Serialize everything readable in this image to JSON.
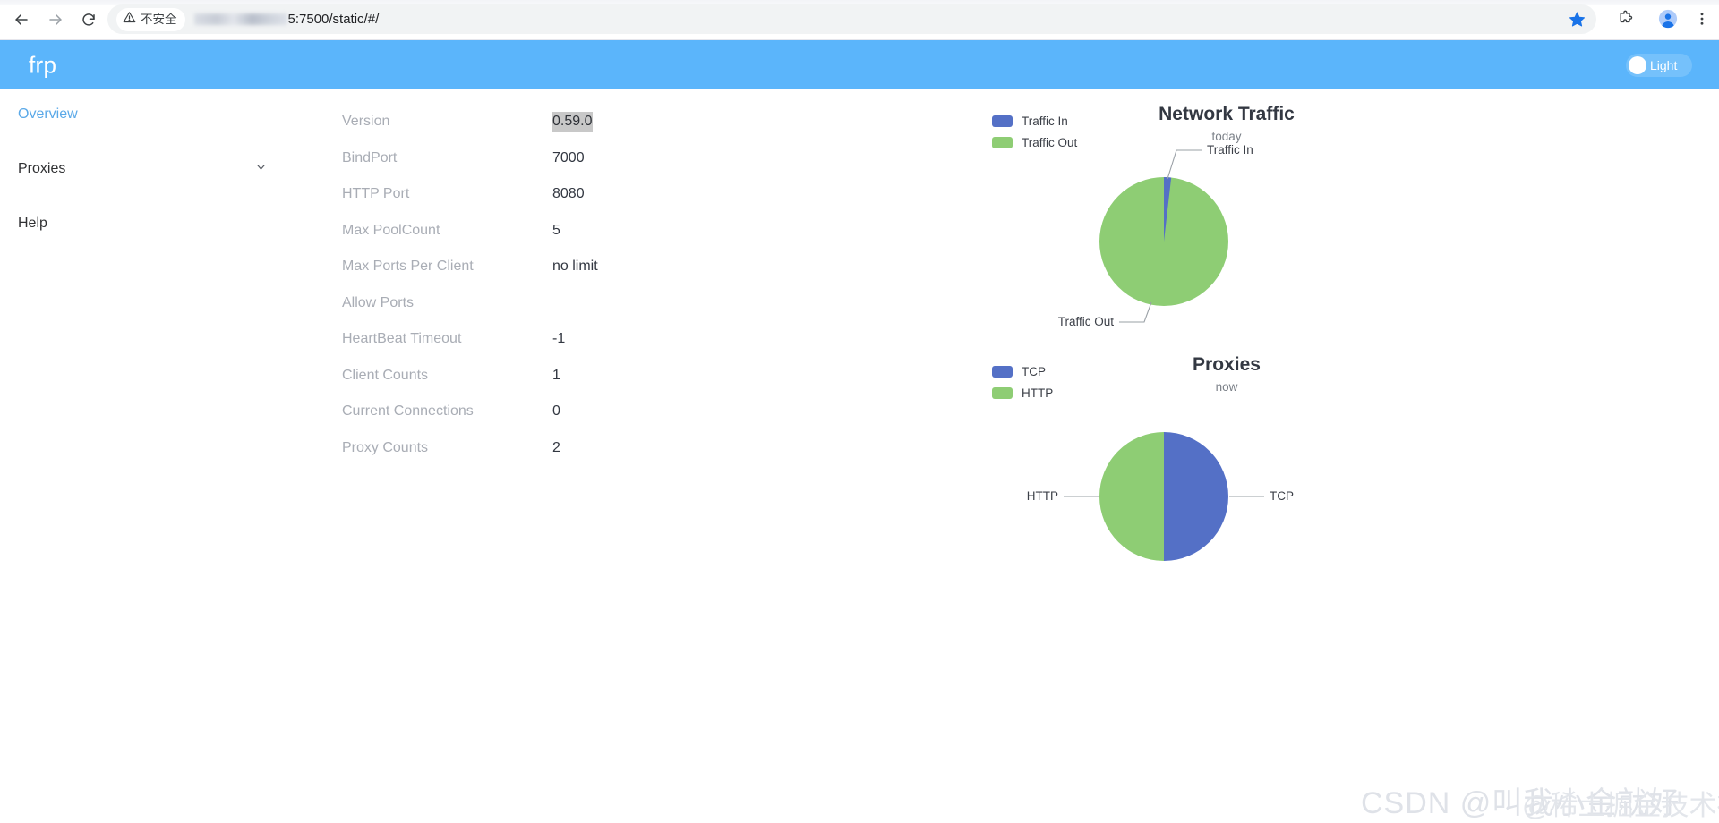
{
  "browser": {
    "back_icon": "arrow-left-icon",
    "forward_icon": "arrow-right-icon",
    "reload_icon": "reload-icon",
    "security_label": "不安全",
    "security_icon": "warning-triangle-icon",
    "url_visible": "5:7500/static/#/",
    "url_redacted": true,
    "bookmark_icon": "star-filled-icon",
    "extensions_icon": "puzzle-piece-icon",
    "profile_icon": "avatar-icon",
    "menu_icon": "three-dot-menu-icon"
  },
  "header": {
    "logo": "frp",
    "theme_toggle_label": "Light",
    "background_color": "#5bb5fb"
  },
  "sidebar": {
    "items": [
      {
        "label": "Overview",
        "active": true
      },
      {
        "label": "Proxies",
        "active": false,
        "expand_icon": "chevron-down-icon"
      },
      {
        "label": "Help",
        "active": false
      }
    ]
  },
  "info": {
    "rows": [
      {
        "key": "Version",
        "value": "0.59.0",
        "selected": true
      },
      {
        "key": "BindPort",
        "value": "7000",
        "selected": false
      },
      {
        "key": "HTTP Port",
        "value": "8080",
        "selected": false
      },
      {
        "key": "Max PoolCount",
        "value": "5",
        "selected": false
      },
      {
        "key": "Max Ports Per Client",
        "value": "no limit",
        "selected": false
      },
      {
        "key": "Allow Ports",
        "value": "",
        "selected": false
      },
      {
        "key": "HeartBeat Timeout",
        "value": "-1",
        "selected": false
      },
      {
        "key": "Client Counts",
        "value": "1",
        "selected": false
      },
      {
        "key": "Current Connections",
        "value": "0",
        "selected": false
      },
      {
        "key": "Proxy Counts",
        "value": "2",
        "selected": false
      }
    ]
  },
  "chart_data": [
    {
      "type": "pie",
      "title": "Network Traffic",
      "subtitle": "today",
      "categories": [
        "Traffic In",
        "Traffic Out"
      ],
      "values": [
        2,
        98
      ],
      "colors": [
        "#5470c6",
        "#8ecd74"
      ],
      "legend": [
        "Traffic In",
        "Traffic Out"
      ],
      "legend_position": "top-left",
      "labels": [
        "Traffic In",
        "Traffic Out"
      ],
      "label_lines": true
    },
    {
      "type": "pie",
      "title": "Proxies",
      "subtitle": "now",
      "categories": [
        "TCP",
        "HTTP"
      ],
      "values": [
        1,
        1
      ],
      "colors": [
        "#5470c6",
        "#8ecd74"
      ],
      "legend": [
        "TCP",
        "HTTP"
      ],
      "legend_position": "top-left",
      "labels": [
        "TCP",
        "HTTP"
      ],
      "label_lines": true
    }
  ],
  "watermark": {
    "main": "CSDN @叫我小金就好",
    "overlay": "@稀土掘金技术社区"
  }
}
